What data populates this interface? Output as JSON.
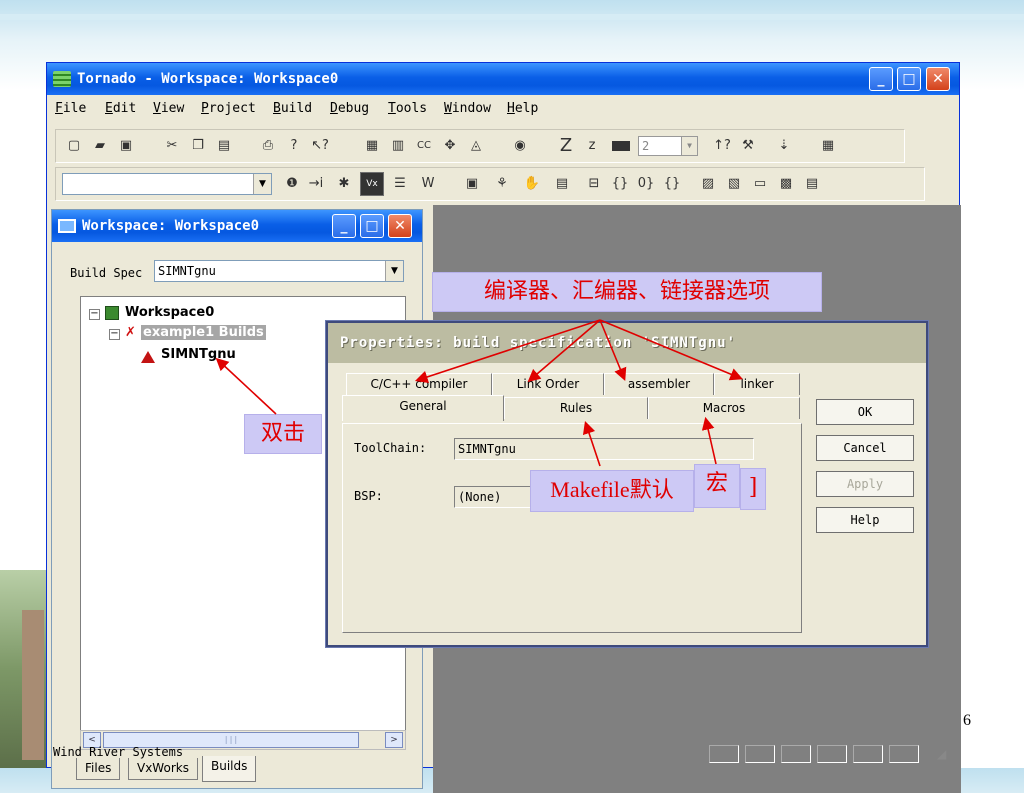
{
  "window": {
    "title": "Tornado - Workspace: Workspace0",
    "minimize": "_",
    "maximize": "□",
    "close": "✕"
  },
  "menu": [
    "File",
    "Edit",
    "View",
    "Project",
    "Build",
    "Debug",
    "Tools",
    "Window",
    "Help"
  ],
  "toolbar1": {
    "icons": [
      "new-icon",
      "open-icon",
      "save-icon",
      "cut-icon",
      "copy-icon",
      "paste-icon",
      "print-icon",
      "help-icon",
      "context-help-icon",
      "build-icon",
      "rebuild-icon",
      "cc-icon",
      "download-icon",
      "target-icon",
      "debug-icon",
      "z-icon",
      "z-small-icon",
      "progress-icon"
    ],
    "cc_label": "CC",
    "z_label": "Z",
    "z_small_label": "z",
    "combo_value": "2"
  },
  "toolbar2": {
    "combo_value": "",
    "icons": [
      "info-icon",
      "step-icon",
      "bug-icon",
      "vx-icon",
      "shell-icon",
      "browser-icon",
      "stop-icon",
      "run-icon",
      "hand-icon",
      "break-icon",
      "step-into-icon",
      "step-over-icon",
      "step-out-icon",
      "continue-icon",
      "memory-icon",
      "registers-icon",
      "variables-icon",
      "backtrace-icon",
      "log-icon"
    ],
    "vx_label": "Vx"
  },
  "workspace": {
    "title": "Workspace: Workspace0",
    "build_spec_label": "Build Spec",
    "build_spec_value": "SIMNTgnu",
    "tree": {
      "root": "Workspace0",
      "project": "example1 Builds",
      "spec": "SIMNTgnu",
      "expand_minus": "−"
    },
    "scroll_left": "<",
    "scroll_right": ">",
    "scroll_grip": "|||",
    "tabs": [
      "Files",
      "VxWorks",
      "Builds"
    ]
  },
  "status": {
    "text": "Wind River Systems"
  },
  "dialog": {
    "title": "Properties: build specification 'SIMNTgnu'",
    "tabs_back": [
      "C/C++ compiler",
      "Link Order",
      "assembler",
      "linker"
    ],
    "tabs_front": [
      "General",
      "Rules",
      "Macros"
    ],
    "toolchain_label": "ToolChain:",
    "toolchain_value": "SIMNTgnu",
    "bsp_label": "BSP:",
    "bsp_value": "(None)",
    "buttons": {
      "ok": "OK",
      "cancel": "Cancel",
      "apply": "Apply",
      "help": "Help"
    }
  },
  "annotations": {
    "options": "编译器、汇编器、链接器选项",
    "double_click": "双击",
    "makefile": "Makefile默认",
    "macro": "宏",
    "bracket": "]"
  },
  "page_number": "6",
  "colors": {
    "annotation_bg": "#cdc9f5",
    "annotation_text": "#e00000",
    "titlebar": "#0a5fe7",
    "mdi": "#808080"
  }
}
